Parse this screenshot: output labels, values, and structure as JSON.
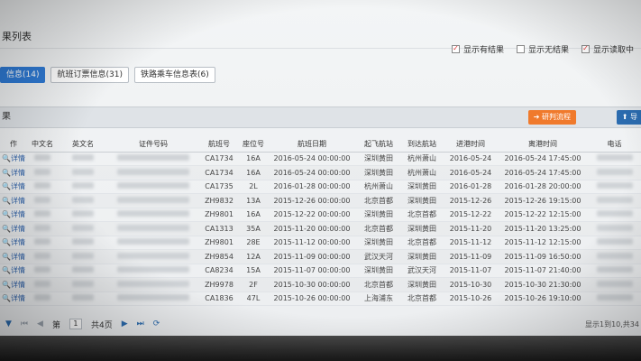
{
  "title": "果列表",
  "filters": [
    {
      "label": "显示有结果",
      "checked": true
    },
    {
      "label": "显示无结果",
      "checked": false
    },
    {
      "label": "显示读取中",
      "checked": true
    }
  ],
  "tabs": [
    {
      "label": "信息(14)",
      "active": true
    },
    {
      "label": "航班订票信息(31)",
      "active": false
    },
    {
      "label": "铁路乘车信息表(6)",
      "active": false
    }
  ],
  "section": {
    "title": "果",
    "btn_orange": "研判流程",
    "btn_blue": "导"
  },
  "table": {
    "headers": [
      "作",
      "中文名",
      "英文名",
      "证件号码",
      "航班号",
      "座位号",
      "航班日期",
      "起飞航站",
      "到达航站",
      "进港时间",
      "离港时间",
      "电话"
    ],
    "op_label": "详情",
    "rows": [
      [
        "CA1734",
        "16A",
        "2016-05-24 00:00:00",
        "深圳黄田",
        "杭州萧山",
        "2016-05-24",
        "2016-05-24 17:45:00"
      ],
      [
        "CA1734",
        "16A",
        "2016-05-24 00:00:00",
        "深圳黄田",
        "杭州萧山",
        "2016-05-24",
        "2016-05-24 17:45:00"
      ],
      [
        "CA1735",
        "2L",
        "2016-01-28 00:00:00",
        "杭州萧山",
        "深圳黄田",
        "2016-01-28",
        "2016-01-28 20:00:00"
      ],
      [
        "ZH9832",
        "13A",
        "2015-12-26 00:00:00",
        "北京首都",
        "深圳黄田",
        "2015-12-26",
        "2015-12-26 19:15:00"
      ],
      [
        "ZH9801",
        "16A",
        "2015-12-22 00:00:00",
        "深圳黄田",
        "北京首都",
        "2015-12-22",
        "2015-12-22 12:15:00"
      ],
      [
        "CA1313",
        "35A",
        "2015-11-20 00:00:00",
        "北京首都",
        "深圳黄田",
        "2015-11-20",
        "2015-11-20 13:25:00"
      ],
      [
        "ZH9801",
        "28E",
        "2015-11-12 00:00:00",
        "深圳黄田",
        "北京首都",
        "2015-11-12",
        "2015-11-12 12:15:00"
      ],
      [
        "ZH9854",
        "12A",
        "2015-11-09 00:00:00",
        "武汉天河",
        "深圳黄田",
        "2015-11-09",
        "2015-11-09 16:50:00"
      ],
      [
        "CA8234",
        "15A",
        "2015-11-07 00:00:00",
        "深圳黄田",
        "武汉天河",
        "2015-11-07",
        "2015-11-07 21:40:00"
      ],
      [
        "ZH9978",
        "2F",
        "2015-10-30 00:00:00",
        "北京首都",
        "深圳黄田",
        "2015-10-30",
        "2015-10-30 21:30:00"
      ],
      [
        "CA1836",
        "47L",
        "2015-10-26 00:00:00",
        "上海浦东",
        "北京首都",
        "2015-10-26",
        "2015-10-26 19:10:00"
      ]
    ]
  },
  "pager": {
    "page_prefix": "第",
    "page_value": "1",
    "total": "共4页",
    "summary": "显示1到10,共34"
  }
}
